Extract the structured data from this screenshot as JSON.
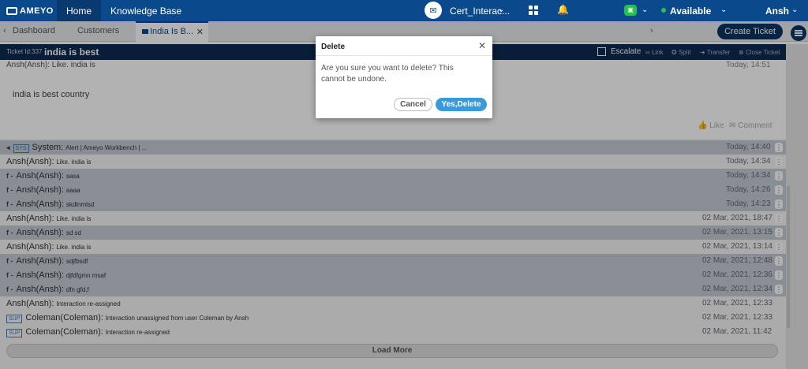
{
  "nav": {
    "logo": "AMEYO",
    "home": "Home",
    "knowledge_base": "Knowledge Base",
    "campaign": "Cert_Interac...",
    "status": "Available",
    "user": "Ansh"
  },
  "tabs": {
    "dashboard": "Dashboard",
    "customers": "Customers",
    "active": "India Is B..."
  },
  "create_ticket": "Create Ticket",
  "ticket": {
    "id": "Ticket Id:337",
    "title": "india is best",
    "escalate": "Escalate",
    "link": "Link",
    "split": "Split",
    "transfer": "Transfer",
    "close_ticket": "Close Ticket"
  },
  "expanded": {
    "author": "Ansh(Ansh): Like. india is",
    "time": "Today, 14:51",
    "body": "india is best country",
    "like": "Like",
    "comment": "Comment"
  },
  "rows": [
    {
      "icon": "sys",
      "author": "System:",
      "msg": "Alert | Ameyo Workbench | ...",
      "time": "Today, 14:40",
      "shaded": true,
      "kebab": true
    },
    {
      "icon": "",
      "author": "Ansh(Ansh):",
      "msg": "Like. india is",
      "time": "Today, 14:34",
      "shaded": false,
      "kebab": true
    },
    {
      "icon": "fb",
      "author": "Ansh(Ansh):",
      "msg": "sasa",
      "time": "Today, 14:34",
      "shaded": true,
      "kebab": true
    },
    {
      "icon": "fb",
      "author": "Ansh(Ansh):",
      "msg": "aaaa",
      "time": "Today, 14:26",
      "shaded": true,
      "kebab": true
    },
    {
      "icon": "fb",
      "author": "Ansh(Ansh):",
      "msg": "skdlnmlsd",
      "time": "Today, 14:23",
      "shaded": true,
      "kebab": true
    },
    {
      "icon": "",
      "author": "Ansh(Ansh):",
      "msg": "Like. india is",
      "time": "02 Mar, 2021, 18:47",
      "shaded": false,
      "kebab": true
    },
    {
      "icon": "fb",
      "author": "Ansh(Ansh):",
      "msg": "sd sd",
      "time": "02 Mar, 2021, 13:15",
      "shaded": true,
      "kebab": true
    },
    {
      "icon": "",
      "author": "Ansh(Ansh):",
      "msg": "Like. india is",
      "time": "02 Mar, 2021, 13:14",
      "shaded": false,
      "kebab": true
    },
    {
      "icon": "fb",
      "author": "Ansh(Ansh):",
      "msg": "sdjfbsdf",
      "time": "02 Mar, 2021, 12:48",
      "shaded": true,
      "kebab": true
    },
    {
      "icon": "fb",
      "author": "Ansh(Ansh):",
      "msg": "djfdfgmn msaf",
      "time": "02 Mar, 2021, 12:36",
      "shaded": true,
      "kebab": true
    },
    {
      "icon": "fb",
      "author": "Ansh(Ansh):",
      "msg": "dfn gfd,f",
      "time": "02 Mar, 2021, 12:34",
      "shaded": true,
      "kebab": true
    },
    {
      "icon": "",
      "author": "Ansh(Ansh):",
      "msg": "Interaction re-assigned",
      "time": "02 Mar, 2021, 12:33",
      "shaded": false,
      "kebab": false
    },
    {
      "icon": "sup",
      "author": "Coleman(Coleman):",
      "msg": "Interaction unassigned from user Coleman by Ansh",
      "time": "02 Mar, 2021, 12:33",
      "shaded": false,
      "kebab": false
    },
    {
      "icon": "sup",
      "author": "Coleman(Coleman):",
      "msg": "Interaction re-assigned",
      "time": "02 Mar, 2021, 11:42",
      "shaded": false,
      "kebab": false
    }
  ],
  "badges": {
    "sys": "SYS",
    "sup": "SUP",
    "fb": "f -"
  },
  "load_more": "Load More",
  "dialog": {
    "title": "Delete",
    "message": "Are you sure you want to delete? This cannot be undone.",
    "cancel": "Cancel",
    "confirm": "Yes,Delete"
  }
}
